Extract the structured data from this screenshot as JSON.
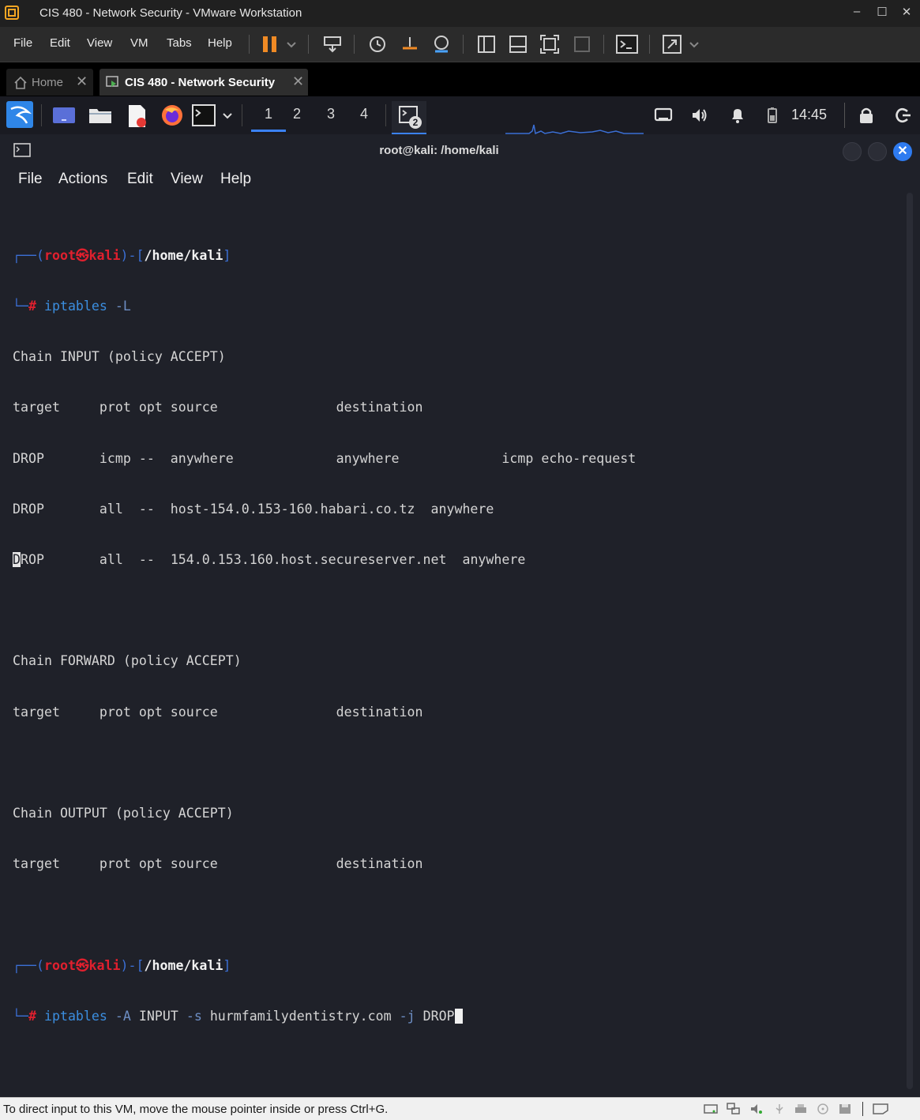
{
  "window": {
    "title": "CIS 480 - Network Security - VMware Workstation",
    "controls": [
      "–",
      "☐",
      "✕"
    ]
  },
  "vmware_menu": [
    "File",
    "Edit",
    "View",
    "VM",
    "Tabs",
    "Help"
  ],
  "tabs": [
    {
      "label": "Home",
      "close": "✕"
    },
    {
      "label": "CIS 480 - Network Security",
      "close": "✕"
    }
  ],
  "kali_panel": {
    "workspaces": [
      "1",
      "2",
      "3",
      "4"
    ],
    "active_workspace": "1",
    "terminal_badge": "2",
    "clock": "14:45"
  },
  "terminal": {
    "title": "root@kali: /home/kali",
    "close_glyph": "✕",
    "menu": [
      "File",
      "Actions",
      "Edit",
      "View",
      "Help"
    ],
    "prompt": {
      "open": "┌──(",
      "user": "root",
      "at": "㉿",
      "host": "kali",
      "mid": ")-[",
      "path": "/home/kali",
      "close": "]",
      "bottom": "└─",
      "hash": "# "
    },
    "cmd1": {
      "bin": "iptables",
      "args": " -L"
    },
    "output": [
      "Chain INPUT (policy ACCEPT)",
      "target     prot opt source               destination",
      "DROP       icmp --  anywhere             anywhere             icmp echo-request",
      "DROP       all  --  host-154.0.153-160.habari.co.tz  anywhere",
      "ROP       all  --  154.0.153.160.host.secureserver.net  anywhere",
      "",
      "Chain FORWARD (policy ACCEPT)",
      "target     prot opt source               destination",
      "",
      "Chain OUTPUT (policy ACCEPT)",
      "target     prot opt source               destination",
      ""
    ],
    "highlighted_char": "D",
    "cmd2": {
      "bin": "iptables",
      "opt_a": " -A",
      "chain": " INPUT",
      "opt_s": " -s",
      "host": " hurmfamilydentistry.com",
      "opt_j": " -j",
      "target": " DROP"
    }
  },
  "statusbar": {
    "message": "To direct input to this VM, move the mouse pointer inside or press Ctrl+G."
  },
  "colors": {
    "terminal_bg": "#1f2129",
    "prompt_blue": "#3b6fd4",
    "prompt_red": "#e0202e",
    "accent_blue": "#3b82f6"
  }
}
